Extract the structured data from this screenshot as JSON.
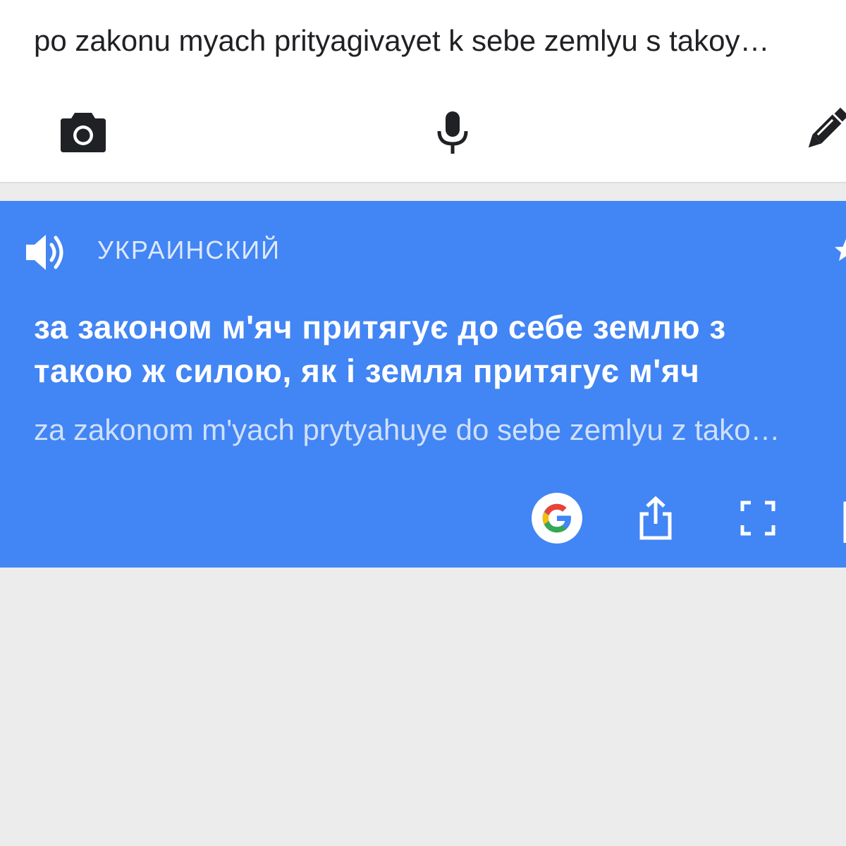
{
  "input": {
    "source_text": "po zakonu myach prityagivayet k sebe zemlyu s takoy…",
    "tools": [
      {
        "name": "camera",
        "icon": "camera-icon"
      },
      {
        "name": "microphone",
        "icon": "microphone-icon"
      },
      {
        "name": "handwriting",
        "icon": "pen-icon"
      }
    ]
  },
  "result": {
    "language_label": "УКРАИНСКИЙ",
    "translation": "за законом м'яч притягує до себе землю з такою ж силою, як і земля притягує м'яч",
    "transliteration": "za zakonom m'yach prytyahuye do sebe zemlyu z tako…",
    "actions": [
      "google-icon",
      "share-icon",
      "fullscreen-icon",
      "copy-icon"
    ]
  },
  "colors": {
    "card_blue": "#4285f4",
    "background": "#ececec",
    "input_bg": "#ffffff",
    "google_blue": "#4285f4",
    "google_red": "#ea4335",
    "google_yellow": "#fbbc05",
    "google_green": "#34a853"
  }
}
